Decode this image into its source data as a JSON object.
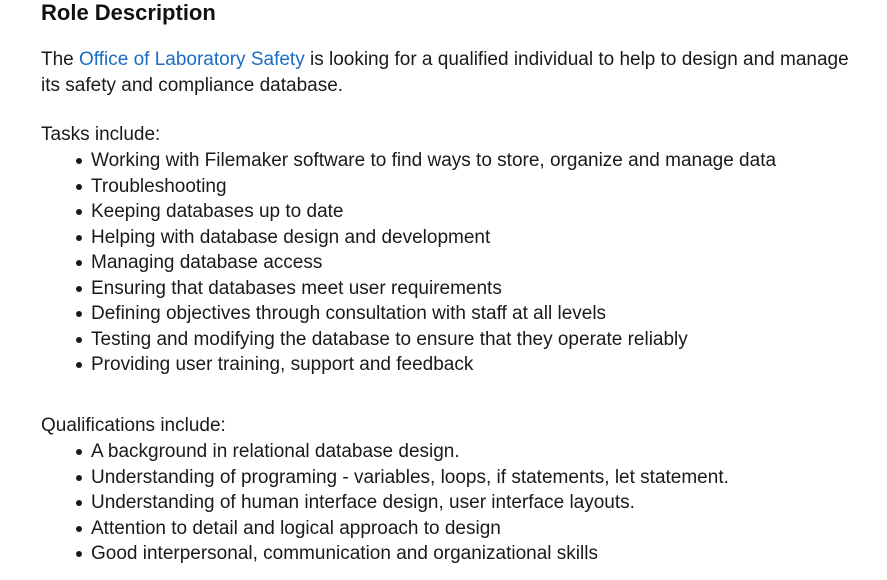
{
  "heading": "Role Description",
  "intro": {
    "prefix": "The ",
    "link_text": "Office of Laboratory Safety",
    "suffix": " is looking for a qualified individual to help to design and manage its safety and compliance database."
  },
  "tasks": {
    "label": "Tasks include:",
    "items": [
      "Working with Filemaker software to find ways to store, organize and manage data",
      "Troubleshooting",
      "Keeping databases up to date",
      "Helping with database design and development",
      "Managing database access",
      "Ensuring that databases meet user requirements",
      "Defining objectives through consultation with staff at all levels",
      "Testing and modifying the database to ensure that they operate reliably",
      "Providing user training, support and feedback"
    ]
  },
  "qualifications": {
    "label": "Qualifications include:",
    "items": [
      "A background in relational database design.",
      "Understanding of programing - variables, loops, if statements, let statement.",
      "Understanding of human interface design, user interface layouts.",
      "Attention to detail and logical approach to design",
      "Good interpersonal, communication and organizational skills"
    ]
  },
  "colors": {
    "text": "#1a1a1a",
    "link": "#1a6cc4"
  }
}
